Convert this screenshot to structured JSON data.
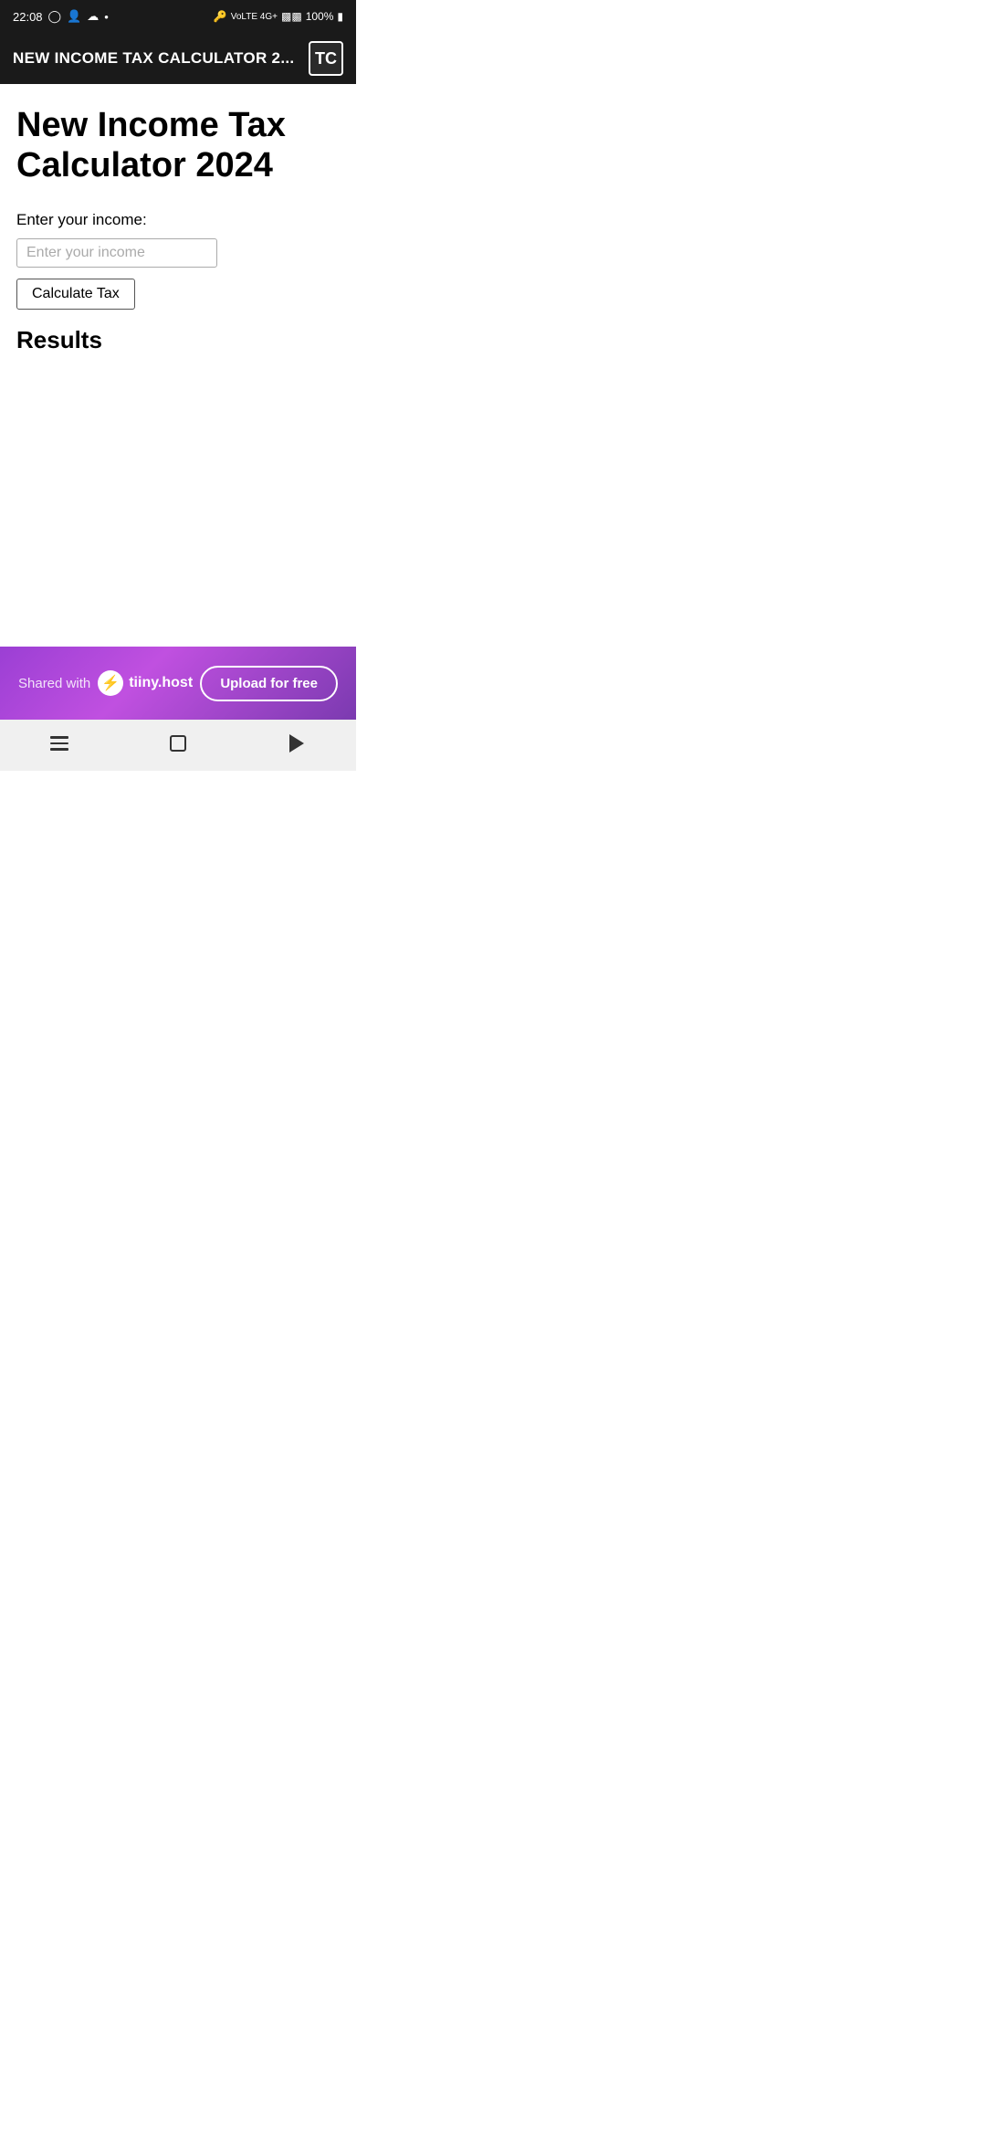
{
  "status_bar": {
    "time": "22:08",
    "battery": "100%",
    "signal_icons": "📶"
  },
  "app_bar": {
    "title": "NEW INCOME TAX CALCULATOR 2...",
    "icon_label": "TC"
  },
  "main": {
    "page_title": "New Income Tax Calculator 2024",
    "input_label": "Enter your income:",
    "input_placeholder": "Enter your income",
    "calculate_button_label": "Calculate Tax",
    "results_heading": "Results"
  },
  "footer": {
    "shared_with_text": "Shared with",
    "brand_name": "tiiny.host",
    "upload_button_label": "Upload for free"
  },
  "nav_bar": {
    "back_label": "Back",
    "home_label": "Home",
    "recents_label": "Recents"
  }
}
